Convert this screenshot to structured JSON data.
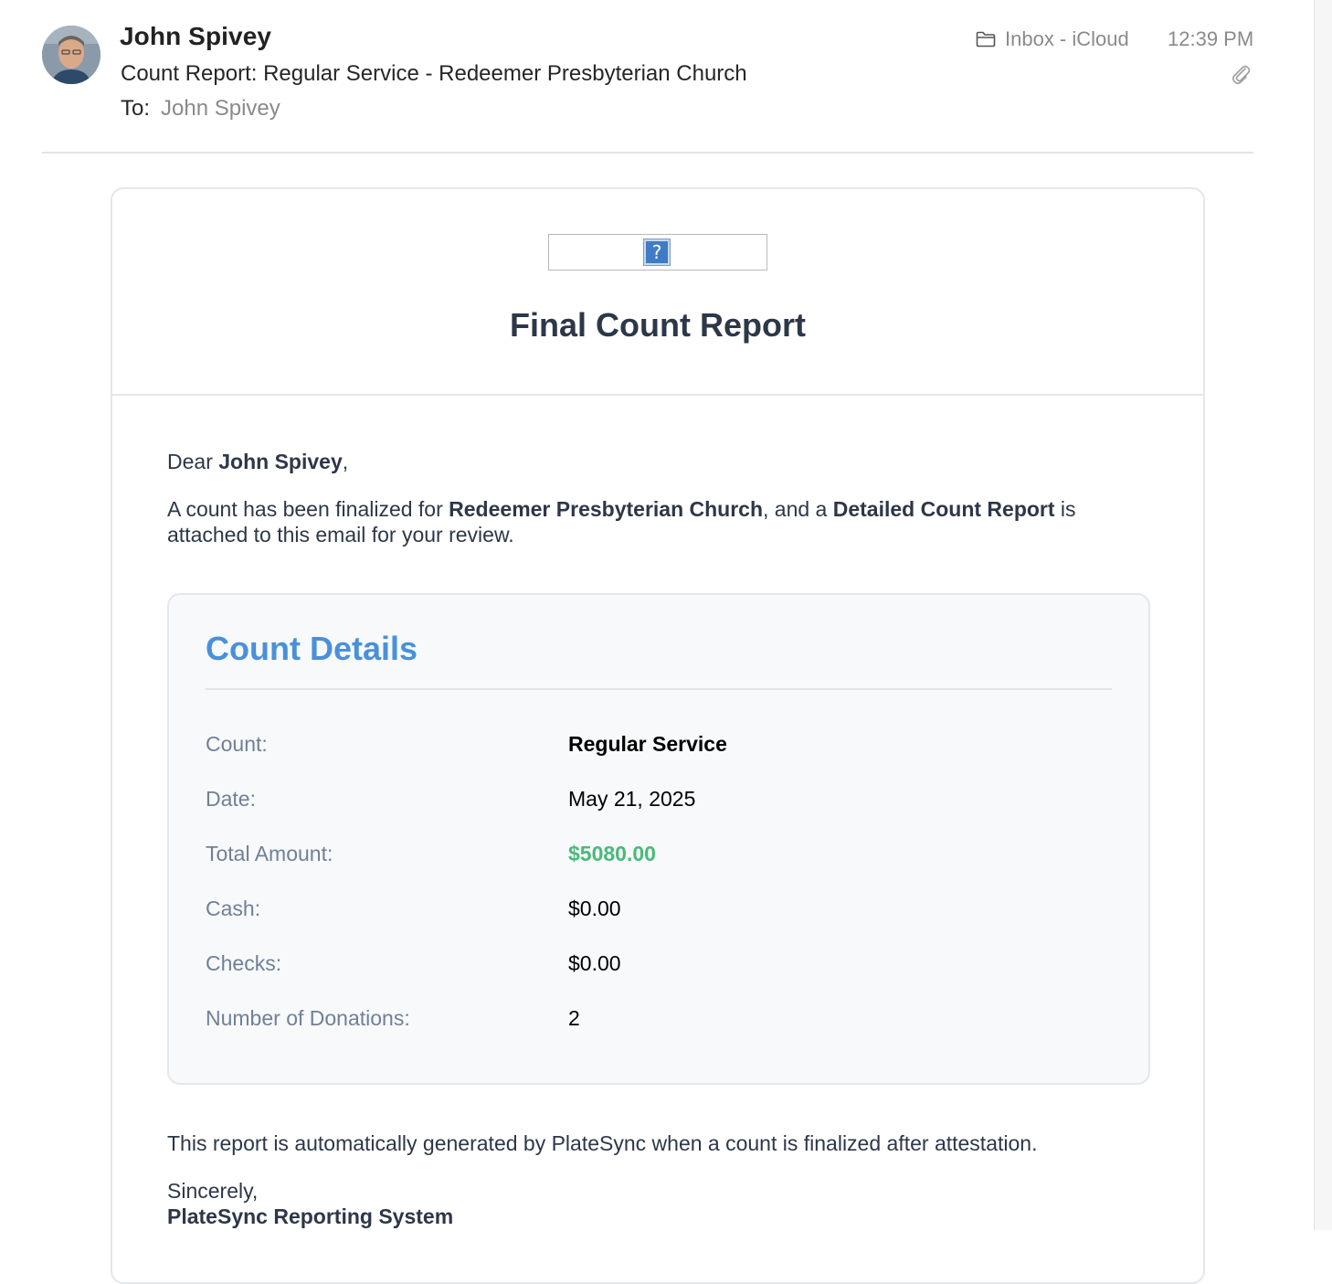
{
  "header": {
    "from_name": "John Spivey",
    "subject": "Count Report: Regular Service - Redeemer Presbyterian Church",
    "to_label": "To:",
    "to_value": "John Spivey",
    "mailbox": "Inbox - iCloud",
    "time": "12:39 PM",
    "icons": [
      "avatar",
      "folder-icon",
      "paperclip-icon"
    ]
  },
  "email": {
    "logo_placeholder": "?",
    "title": "Final Count Report",
    "greeting_prefix": "Dear ",
    "greeting_name": "John Spivey",
    "greeting_suffix": ",",
    "intro_part1": "A count has been finalized for ",
    "intro_church": "Redeemer Presbyterian Church",
    "intro_part2": ", and a ",
    "intro_report": "Detailed Count Report",
    "intro_part3": " is attached to this email for your review.",
    "details": {
      "title": "Count Details",
      "rows": [
        {
          "label": "Count:",
          "value": "Regular Service"
        },
        {
          "label": "Date:",
          "value": "May 21, 2025"
        },
        {
          "label": "Total Amount:",
          "value": "$5080.00"
        },
        {
          "label": "Cash:",
          "value": "$0.00"
        },
        {
          "label": "Checks:",
          "value": "$0.00"
        },
        {
          "label": "Number of Donations:",
          "value": "2"
        }
      ]
    },
    "footer": "This report is automatically generated by PlateSync when a count is finalized after attestation.",
    "signoff": "Sincerely,",
    "signature": "PlateSync Reporting System"
  },
  "colors": {
    "title": "#2d3748",
    "details_title": "#4a90d9",
    "total_amount": "#48bb78",
    "label": "#718096"
  }
}
